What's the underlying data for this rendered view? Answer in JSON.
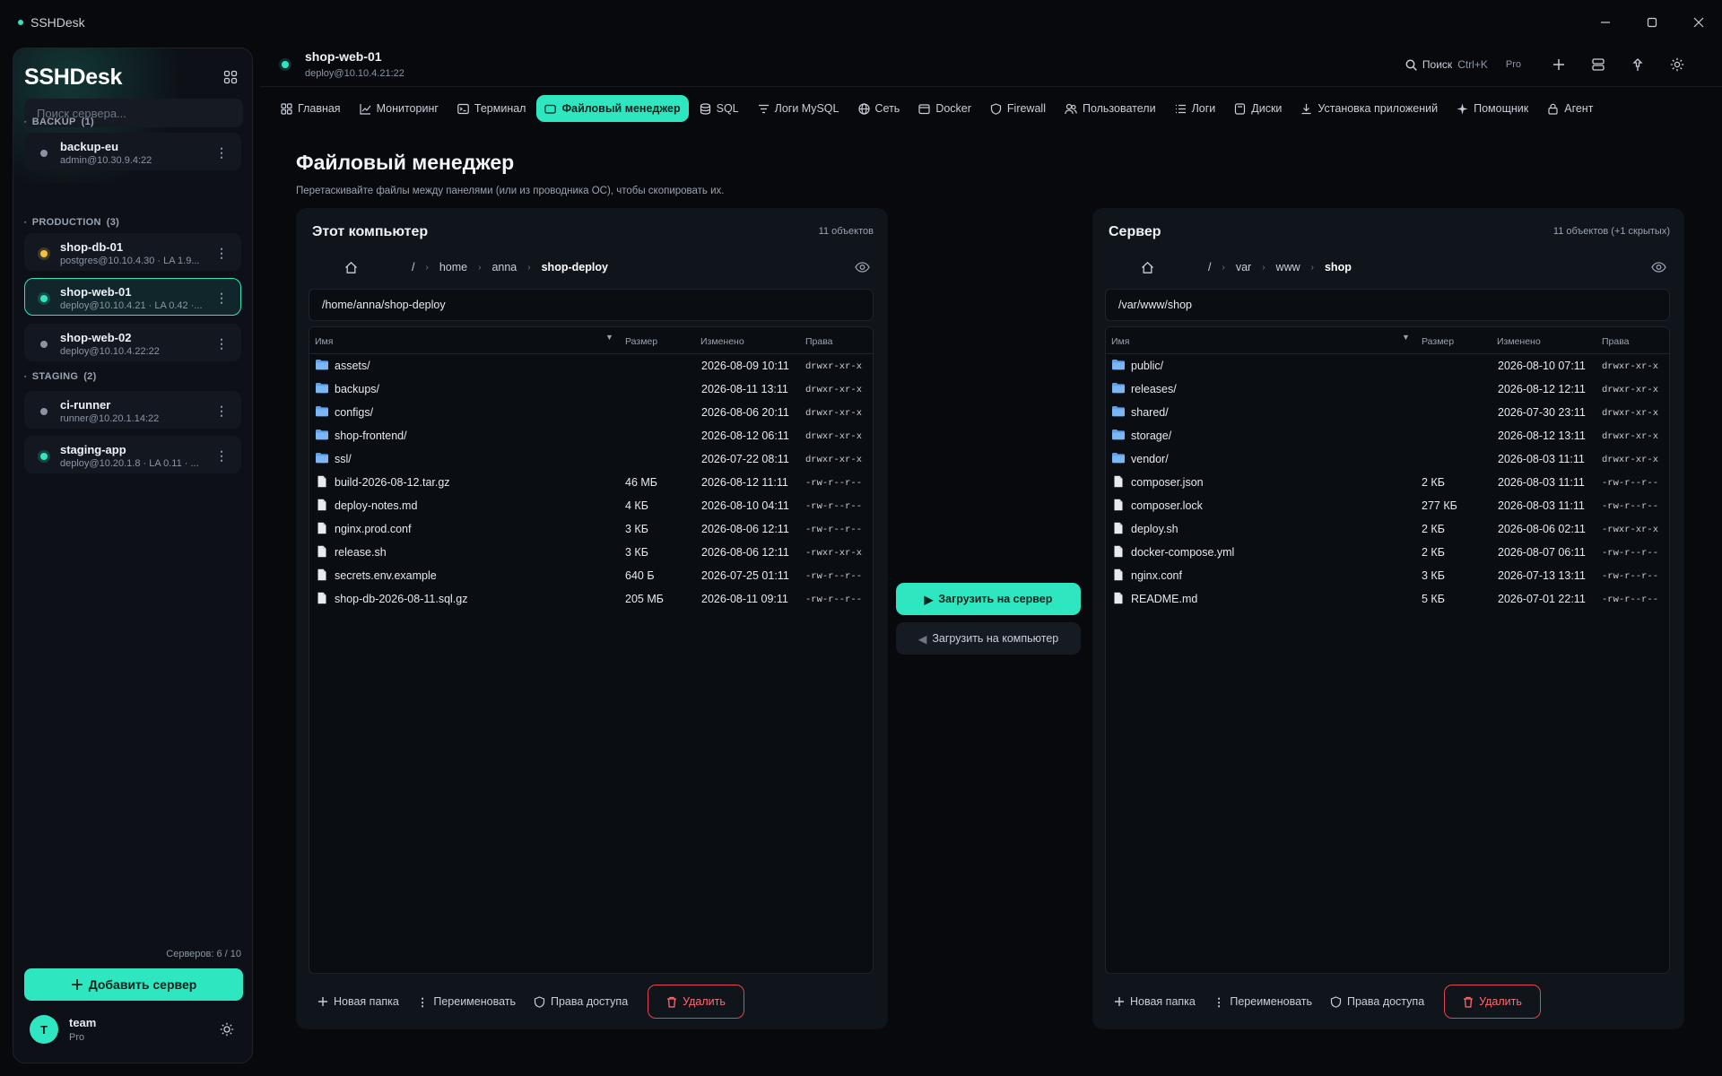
{
  "window": {
    "title": "SSHDesk"
  },
  "sidebar": {
    "brand": "SSHDesk",
    "search_placeholder": "Поиск сервера...",
    "groups": [
      {
        "label": "BACKUP",
        "count": "(1)"
      },
      {
        "label": "PRODUCTION",
        "count": "(3)"
      },
      {
        "label": "STAGING",
        "count": "(2)"
      }
    ],
    "servers": [
      {
        "name": "backup-eu",
        "sub": "admin@10.30.9.4:22",
        "status_color": "#8a93a1"
      },
      {
        "name": "shop-db-01",
        "sub": "postgres@10.10.4.30  ·  LA 1.9...",
        "status_color": "#f5c33b"
      },
      {
        "name": "shop-web-01",
        "sub": "deploy@10.10.4.21  ·  LA 0.42 ·...",
        "status_color": "#2ee6c0"
      },
      {
        "name": "shop-web-02",
        "sub": "deploy@10.10.4.22:22",
        "status_color": "#8a93a1"
      },
      {
        "name": "ci-runner",
        "sub": "runner@10.20.1.14:22",
        "status_color": "#8a93a1"
      },
      {
        "name": "staging-app",
        "sub": "deploy@10.20.1.8  ·  LA 0.11 · ...",
        "status_color": "#2ee6c0"
      }
    ],
    "server_count": "Серверов: 6 / 10",
    "add_label": "Добавить сервер",
    "user": {
      "initial": "T",
      "name": "team",
      "plan": "Pro"
    }
  },
  "header": {
    "server_name": "shop-web-01",
    "server_addr": "deploy@10.10.4.21:22",
    "search_label": "Поиск",
    "search_shortcut": "Ctrl+K",
    "plan": "Pro"
  },
  "tabs": [
    {
      "label": "Главная",
      "icon": "grid-icon"
    },
    {
      "label": "Мониторинг",
      "icon": "chart-icon"
    },
    {
      "label": "Терминал",
      "icon": "terminal-icon"
    },
    {
      "label": "Файловый менеджер",
      "icon": "folder-icon",
      "active": true
    },
    {
      "label": "SQL",
      "icon": "database-icon"
    },
    {
      "label": "Логи MySQL",
      "icon": "filter-icon"
    },
    {
      "label": "Сеть",
      "icon": "globe-icon"
    },
    {
      "label": "Docker",
      "icon": "container-icon"
    },
    {
      "label": "Firewall",
      "icon": "shield-icon"
    },
    {
      "label": "Пользователи",
      "icon": "users-icon"
    },
    {
      "label": "Логи",
      "icon": "list-icon"
    },
    {
      "label": "Диски",
      "icon": "disk-icon"
    },
    {
      "label": "Установка приложений",
      "icon": "download-icon"
    },
    {
      "label": "Помощник",
      "icon": "sparkle-icon"
    },
    {
      "label": "Агент",
      "icon": "lock-icon"
    }
  ],
  "page": {
    "title": "Файловый менеджер",
    "subtitle": "Перетаскивайте файлы между панелями (или из проводника ОС), чтобы скопировать их."
  },
  "transfer": {
    "upload": "Загрузить на сервер",
    "download": "Загрузить на компьютер"
  },
  "columns": {
    "name": "Имя",
    "size": "Размер",
    "modified": "Изменено",
    "perms": "Права"
  },
  "actions": {
    "new_folder": "Новая папка",
    "rename": "Переименовать",
    "perms": "Права доступа",
    "delete": "Удалить"
  },
  "local": {
    "title": "Этот компьютер",
    "count": "11 объектов",
    "crumbs": [
      "/",
      "home",
      "anna",
      "shop-deploy"
    ],
    "path": "/home/anna/shop-deploy",
    "files": [
      {
        "name": "assets/",
        "dir": true,
        "size": "",
        "modified": "2026-08-09 10:11",
        "perms": "drwxr-xr-x"
      },
      {
        "name": "backups/",
        "dir": true,
        "size": "",
        "modified": "2026-08-11 13:11",
        "perms": "drwxr-xr-x"
      },
      {
        "name": "configs/",
        "dir": true,
        "size": "",
        "modified": "2026-08-06 20:11",
        "perms": "drwxr-xr-x"
      },
      {
        "name": "shop-frontend/",
        "dir": true,
        "size": "",
        "modified": "2026-08-12 06:11",
        "perms": "drwxr-xr-x"
      },
      {
        "name": "ssl/",
        "dir": true,
        "size": "",
        "modified": "2026-07-22 08:11",
        "perms": "drwxr-xr-x"
      },
      {
        "name": "build-2026-08-12.tar.gz",
        "dir": false,
        "size": "46 МБ",
        "modified": "2026-08-12 11:11",
        "perms": "-rw-r--r--"
      },
      {
        "name": "deploy-notes.md",
        "dir": false,
        "size": "4 КБ",
        "modified": "2026-08-10 04:11",
        "perms": "-rw-r--r--"
      },
      {
        "name": "nginx.prod.conf",
        "dir": false,
        "size": "3 КБ",
        "modified": "2026-08-06 12:11",
        "perms": "-rw-r--r--"
      },
      {
        "name": "release.sh",
        "dir": false,
        "size": "3 КБ",
        "modified": "2026-08-06 12:11",
        "perms": "-rwxr-xr-x"
      },
      {
        "name": "secrets.env.example",
        "dir": false,
        "size": "640 Б",
        "modified": "2026-07-25 01:11",
        "perms": "-rw-r--r--"
      },
      {
        "name": "shop-db-2026-08-11.sql.gz",
        "dir": false,
        "size": "205 МБ",
        "modified": "2026-08-11 09:11",
        "perms": "-rw-r--r--"
      }
    ]
  },
  "remote": {
    "title": "Сервер",
    "count": "11 объектов (+1 скрытых)",
    "crumbs": [
      "/",
      "var",
      "www",
      "shop"
    ],
    "path": "/var/www/shop",
    "files": [
      {
        "name": "public/",
        "dir": true,
        "size": "",
        "modified": "2026-08-10 07:11",
        "perms": "drwxr-xr-x"
      },
      {
        "name": "releases/",
        "dir": true,
        "size": "",
        "modified": "2026-08-12 12:11",
        "perms": "drwxr-xr-x"
      },
      {
        "name": "shared/",
        "dir": true,
        "size": "",
        "modified": "2026-07-30 23:11",
        "perms": "drwxr-xr-x"
      },
      {
        "name": "storage/",
        "dir": true,
        "size": "",
        "modified": "2026-08-12 13:11",
        "perms": "drwxr-xr-x"
      },
      {
        "name": "vendor/",
        "dir": true,
        "size": "",
        "modified": "2026-08-03 11:11",
        "perms": "drwxr-xr-x"
      },
      {
        "name": "composer.json",
        "dir": false,
        "size": "2 КБ",
        "modified": "2026-08-03 11:11",
        "perms": "-rw-r--r--"
      },
      {
        "name": "composer.lock",
        "dir": false,
        "size": "277 КБ",
        "modified": "2026-08-03 11:11",
        "perms": "-rw-r--r--"
      },
      {
        "name": "deploy.sh",
        "dir": false,
        "size": "2 КБ",
        "modified": "2026-08-06 02:11",
        "perms": "-rwxr-xr-x"
      },
      {
        "name": "docker-compose.yml",
        "dir": false,
        "size": "2 КБ",
        "modified": "2026-08-07 06:11",
        "perms": "-rw-r--r--"
      },
      {
        "name": "nginx.conf",
        "dir": false,
        "size": "3 КБ",
        "modified": "2026-07-13 13:11",
        "perms": "-rw-r--r--"
      },
      {
        "name": "README.md",
        "dir": false,
        "size": "5 КБ",
        "modified": "2026-07-01 22:11",
        "perms": "-rw-r--r--"
      }
    ]
  },
  "colors": {
    "accent": "#2ee6c0",
    "danger": "#e0464f",
    "folder": "#5aa2f0"
  }
}
